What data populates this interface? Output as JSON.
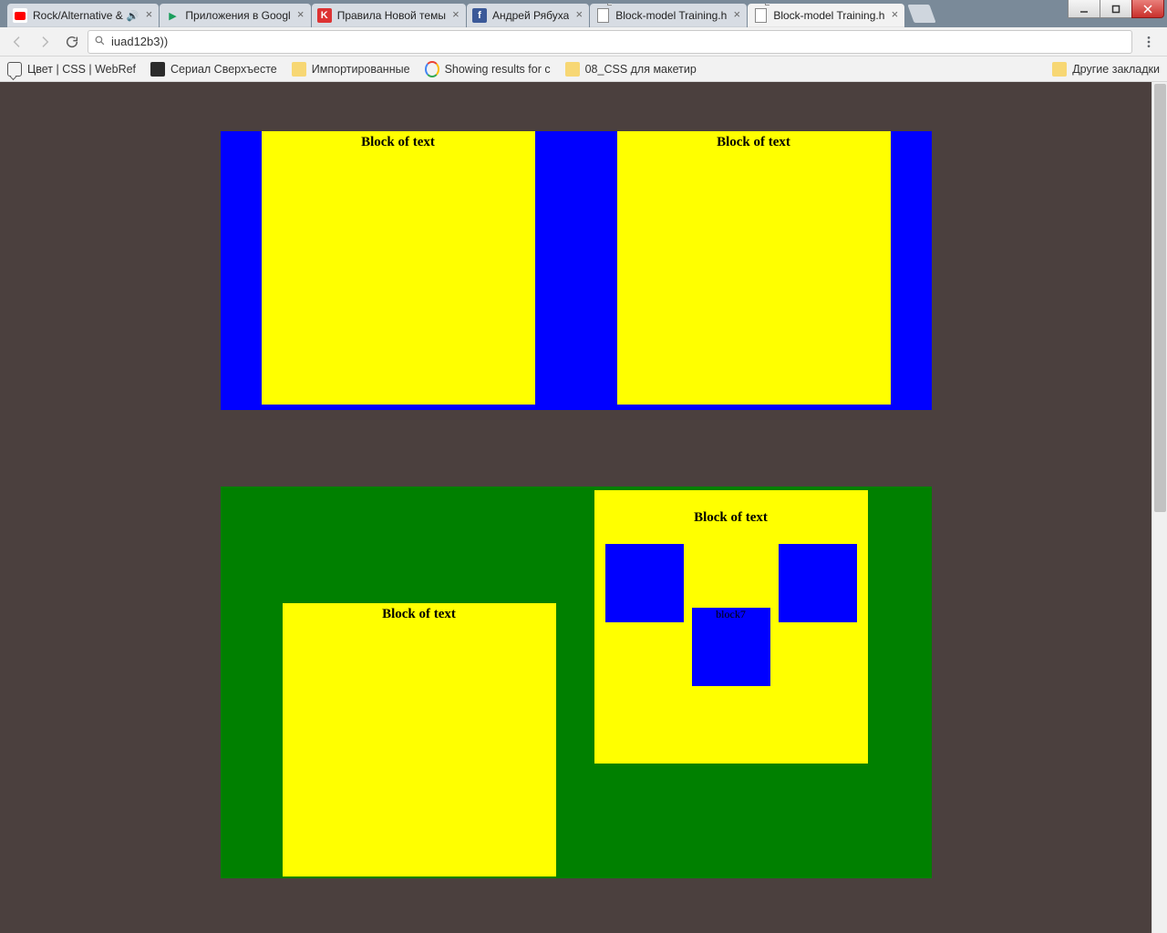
{
  "window_buttons": {
    "min": "–",
    "max": "❐",
    "close": "✕"
  },
  "tabs": [
    {
      "label": "Rock/Alternative &",
      "favicon": "youtube",
      "audio": true
    },
    {
      "label": "Приложения в Googl",
      "favicon": "play"
    },
    {
      "label": "Правила Новой темы",
      "favicon": "red"
    },
    {
      "label": "Андрей Рябуха",
      "favicon": "fb"
    },
    {
      "label": "Block-model Training.h",
      "favicon": "file"
    },
    {
      "label": "Block-model Training.h",
      "favicon": "file",
      "active": true
    }
  ],
  "omnibox": {
    "value": "iuad12b3))"
  },
  "bookmarks": [
    {
      "icon": "chat",
      "label": "Цвет | CSS | WebRef"
    },
    {
      "icon": "dark",
      "label": "Сериал Сверхъесте"
    },
    {
      "icon": "folder",
      "label": "Импортированные"
    },
    {
      "icon": "goog",
      "label": "Showing results for c"
    },
    {
      "icon": "folder",
      "label": "08_CSS для макетир"
    }
  ],
  "bookmarks_overflow": "Другие закладки",
  "blocks": {
    "blue_a": "Block of text",
    "blue_b": "Block of text",
    "green_a": "Block of text",
    "green_b_title": "Block of text",
    "green_b_mid": "block7"
  }
}
